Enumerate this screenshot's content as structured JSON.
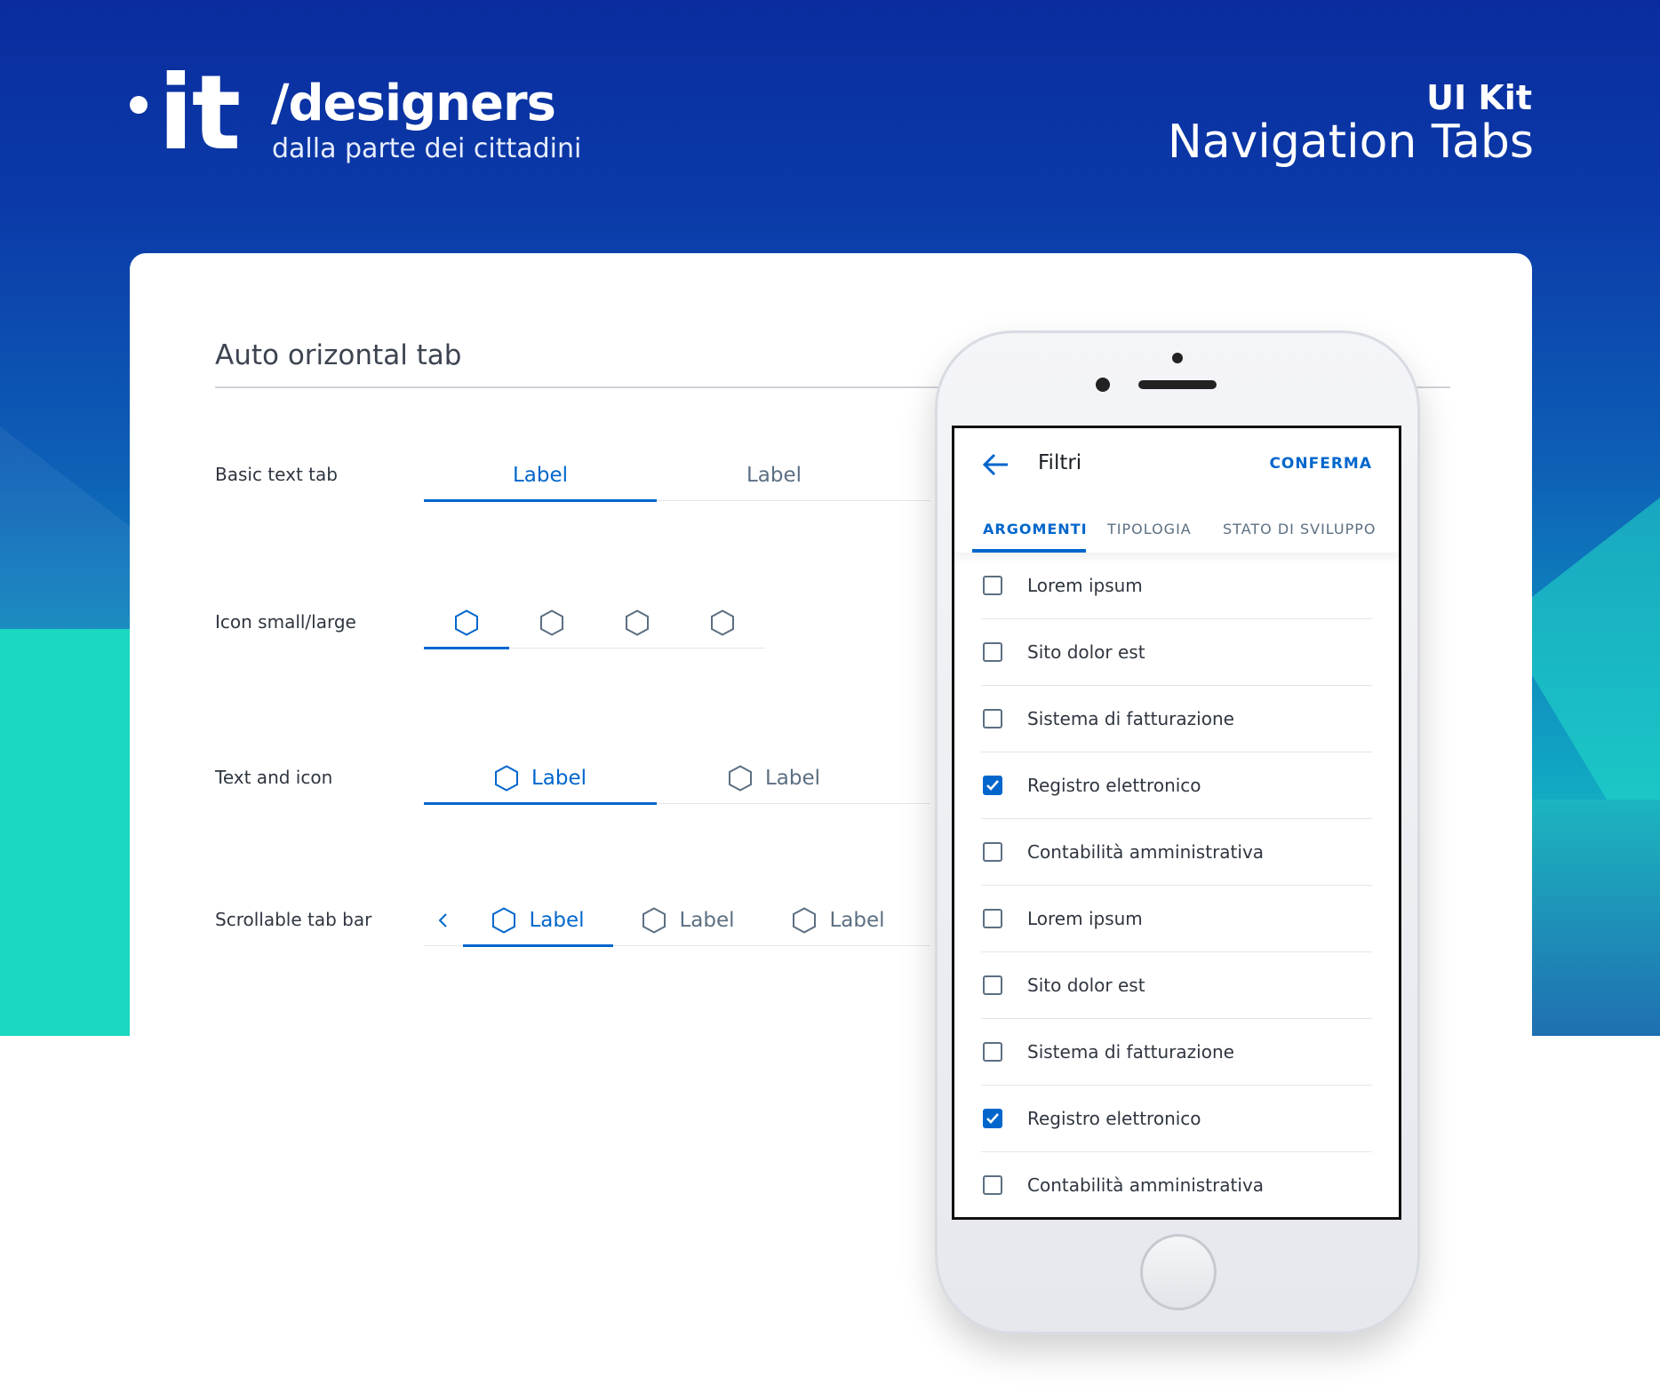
{
  "brand": {
    "logo_text": "it",
    "title": "/designers",
    "subtitle": "dalla parte dei cittadini"
  },
  "header": {
    "kit_label": "UI Kit",
    "kit_title": "Navigation Tabs"
  },
  "section": {
    "title": "Auto orizontal tab"
  },
  "rows": {
    "basic_text_tab": {
      "label": "Basic text tab",
      "tabs": [
        "Label",
        "Label"
      ],
      "active_index": 0
    },
    "icon_small_large": {
      "label": "Icon small/large",
      "icons": [
        "hexagon-icon",
        "hexagon-icon",
        "hexagon-icon",
        "hexagon-icon"
      ],
      "active_index": 0
    },
    "text_and_icon": {
      "label": "Text and icon",
      "tabs": [
        "Label",
        "Label"
      ],
      "active_index": 0
    },
    "scrollable_tab_bar": {
      "label": "Scrollable tab bar",
      "tabs": [
        "Label",
        "Label",
        "Label"
      ],
      "active_index": 0,
      "nav_icon": "chevron-left-icon"
    }
  },
  "phone": {
    "title": "Filtri",
    "confirm": "CONFERMA",
    "back_icon": "arrow-left-icon",
    "tabs": [
      "ARGOMENTI",
      "TIPOLOGIA",
      "STATO DI SVILUPPO"
    ],
    "active_tab": 0,
    "items": [
      {
        "label": "Lorem ipsum",
        "checked": false
      },
      {
        "label": "Sito dolor est",
        "checked": false
      },
      {
        "label": "Sistema di fatturazione",
        "checked": false
      },
      {
        "label": "Registro elettronico",
        "checked": true
      },
      {
        "label": "Contabilità amministrativa",
        "checked": false
      },
      {
        "label": "Lorem ipsum",
        "checked": false
      },
      {
        "label": "Sito dolor est",
        "checked": false
      },
      {
        "label": "Sistema di fatturazione",
        "checked": false
      },
      {
        "label": "Registro elettronico",
        "checked": true
      },
      {
        "label": "Contabilità amministrativa",
        "checked": false
      }
    ]
  },
  "colors": {
    "accent": "#0066cc",
    "text_muted": "#5c6f82",
    "hero_top": "#0a2c9e",
    "hero_bottom": "#14c8bd"
  }
}
